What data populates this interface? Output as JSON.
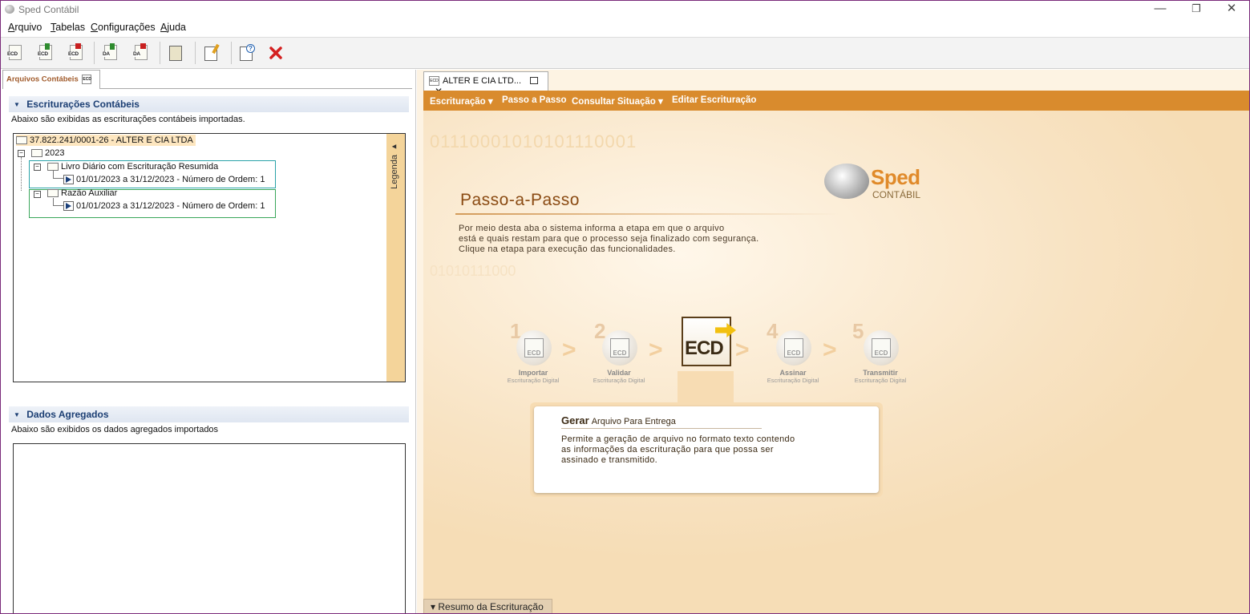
{
  "window": {
    "title": "Sped Contábil",
    "controls": {
      "minimize": "—",
      "restore": "❐",
      "close": "✕"
    }
  },
  "menu": [
    "Arquivo",
    "Tabelas",
    "Configurações",
    "Ajuda"
  ],
  "toolbar": {
    "icon_label_ecd": "ECD",
    "icon_label_da": "DA"
  },
  "left": {
    "tab_label": "Arquivos Contábeis",
    "tab_icon_text": "ECD",
    "sec1": {
      "title": "Escriturações Contábeis",
      "desc": "Abaixo são exibidas as escriturações contábeis importadas."
    },
    "tree": {
      "company": "37.822.241/0001-26 - ALTER E CIA LTDA",
      "year": "2023",
      "book1": "Livro Diário com Escrituração Resumida",
      "book1_period": "01/01/2023 a 31/12/2023 - Número de Ordem: 1",
      "book2": "Razão Auxiliar",
      "book2_period": "01/01/2023 a 31/12/2023 - Número de Ordem: 1",
      "legend": "Legenda ▸"
    },
    "sec2": {
      "title": "Dados Agregados",
      "desc": "Abaixo são exibidos os dados agregados importados"
    }
  },
  "right": {
    "tab_label": "ALTER E CIA LTD...",
    "tab_icon_text": "ECD",
    "orange_menu": [
      "Escrituração ▾",
      "Passo a Passo",
      "Consultar Situação ▾",
      "Editar Escrituração"
    ],
    "binary1": "01110001010101110001",
    "binary2": "01010111000",
    "logo": {
      "name": "Sped",
      "sub": "CONTÁBIL"
    },
    "title": "Passo-a-Passo",
    "desc1": "Por meio desta aba o sistema informa a etapa em que o arquivo",
    "desc2": "está e quais restam para que o processo seja finalizado com segurança.",
    "desc3": "Clique na etapa para execução das funcionalidades.",
    "steps": [
      {
        "num": "1",
        "label": "Importar",
        "sub": "Escrituração Digital",
        "icon": "ECD"
      },
      {
        "num": "2",
        "label": "Validar",
        "sub": "Escrituração Digital",
        "icon": "ECD"
      },
      {
        "num": "4",
        "label": "Assinar",
        "sub": "Escrituração Digital",
        "icon": "ECD"
      },
      {
        "num": "5",
        "label": "Transmitir",
        "sub": "Escrituração Digital",
        "icon": "ECD"
      }
    ],
    "current_step_icon": "ECD",
    "chevron": ">",
    "info": {
      "head_bold": "Gerar",
      "head_rest": "Arquivo Para Entrega",
      "line1": "Permite a geração de arquivo no formato texto contendo",
      "line2": "as informações da escrituração para que possa ser",
      "line3": "assinado e transmitido."
    },
    "resumo": "▾ Resumo da Escrituração"
  },
  "colors": {
    "orange": "#d98b2d",
    "section_title": "#1b3e73",
    "legend_bg": "#f4d49a",
    "highlight1": "#29a2a8",
    "highlight2": "#3aa65a",
    "close_red": "#d42020"
  }
}
